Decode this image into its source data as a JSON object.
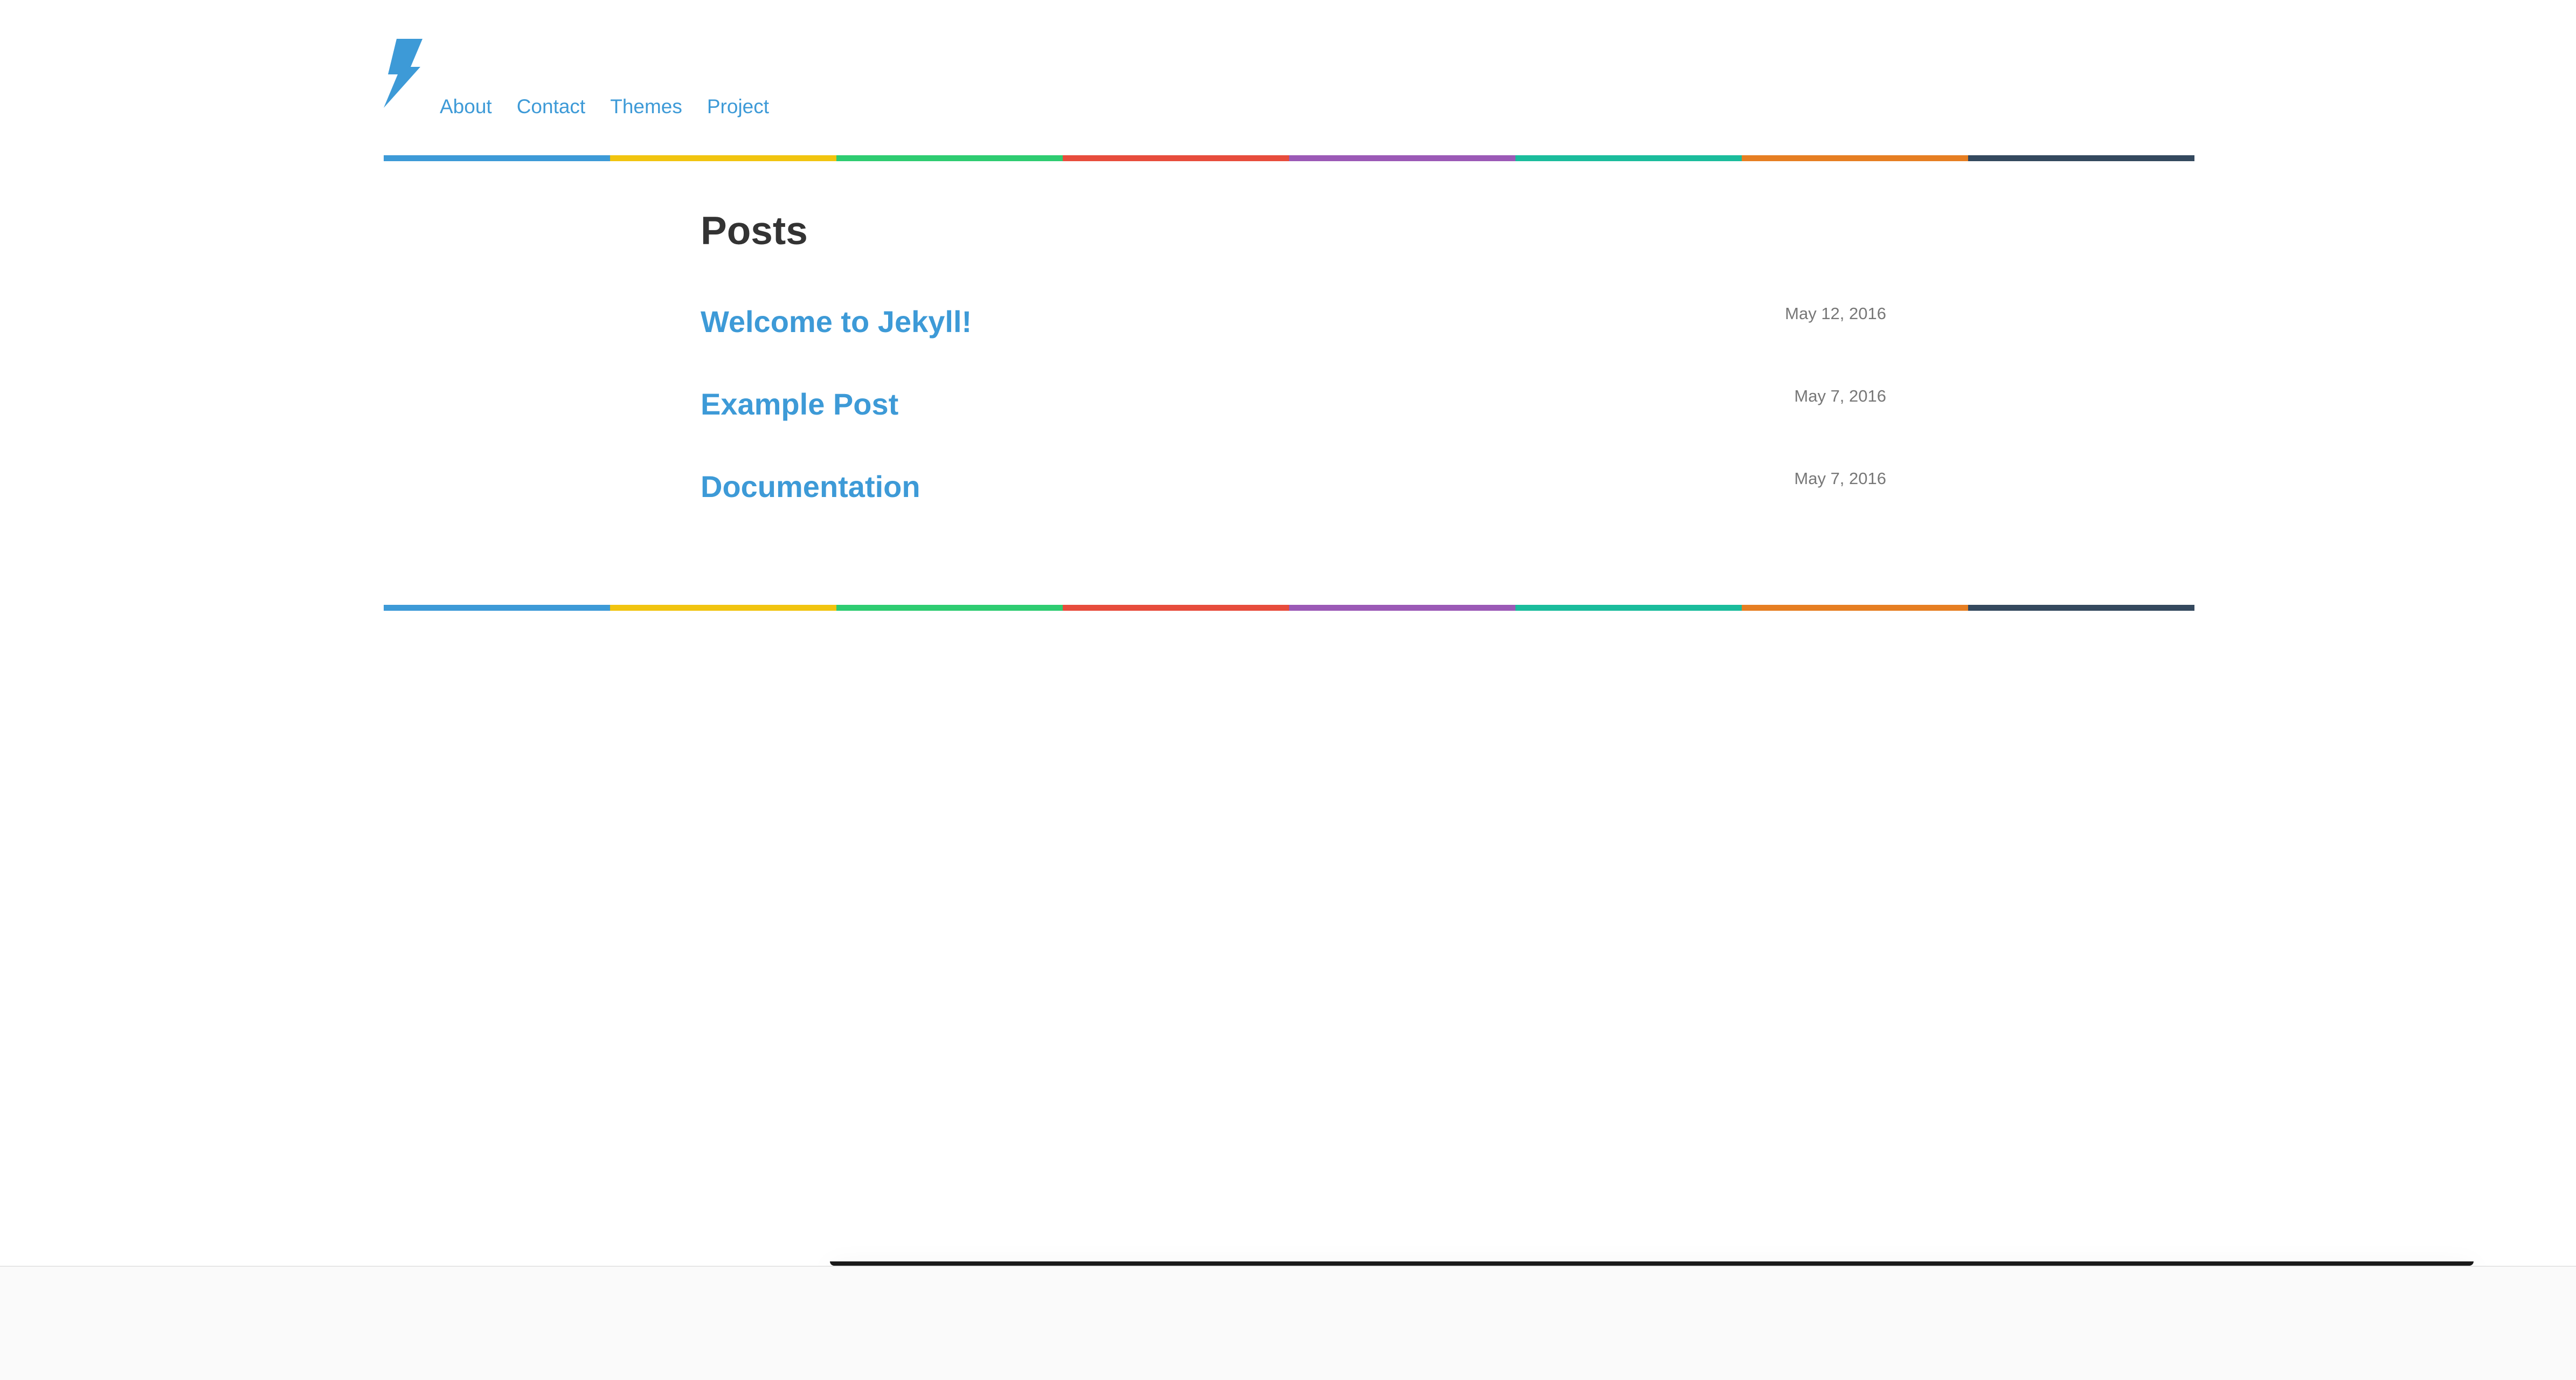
{
  "site": {
    "logo_icon": "lightning-bolt-icon",
    "accent_color": "#3d9ad7"
  },
  "nav": {
    "items": [
      {
        "label": "About"
      },
      {
        "label": "Contact"
      },
      {
        "label": "Themes"
      },
      {
        "label": "Project"
      }
    ]
  },
  "rainbow_colors": [
    "#3d9ad7",
    "#f1c40f",
    "#2ecc71",
    "#e74c3c",
    "#9b59b6",
    "#1abc9c",
    "#e67e22",
    "#34495e"
  ],
  "main": {
    "title": "Posts",
    "posts": [
      {
        "title": "Welcome to Jekyll!",
        "date": "May 12, 2016"
      },
      {
        "title": "Example Post",
        "date": "May 7, 2016"
      },
      {
        "title": "Documentation",
        "date": "May 7, 2016"
      }
    ]
  }
}
